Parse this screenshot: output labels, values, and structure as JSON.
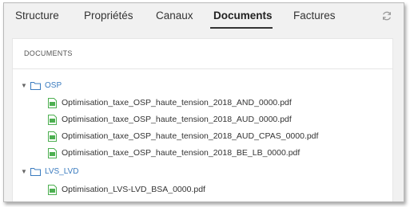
{
  "tabs": [
    {
      "label": "Structure"
    },
    {
      "label": "Propriétés"
    },
    {
      "label": "Canaux"
    },
    {
      "label": "Documents"
    },
    {
      "label": "Factures"
    }
  ],
  "active_tab": "Documents",
  "refresh_icon": "refresh-icon",
  "panel": {
    "title": "DOCUMENTS"
  },
  "tree": {
    "folders": [
      {
        "name": "OSP",
        "expanded": true,
        "files": [
          "Optimisation_taxe_OSP_haute_tension_2018_AND_0000.pdf",
          "Optimisation_taxe_OSP_haute_tension_2018_AUD_0000.pdf",
          "Optimisation_taxe_OSP_haute_tension_2018_AUD_CPAS_0000.pdf",
          "Optimisation_taxe_OSP_haute_tension_2018_BE_LB_0000.pdf"
        ]
      },
      {
        "name": "LVS_LVD",
        "expanded": true,
        "files": [
          "Optimisation_LVS-LVD_BSA_0000.pdf"
        ]
      }
    ]
  },
  "colors": {
    "folder_link": "#3a7bbf",
    "file_icon": "#4caf50",
    "tab_background": "#f1f1f1",
    "panel_background": "#ffffff"
  }
}
